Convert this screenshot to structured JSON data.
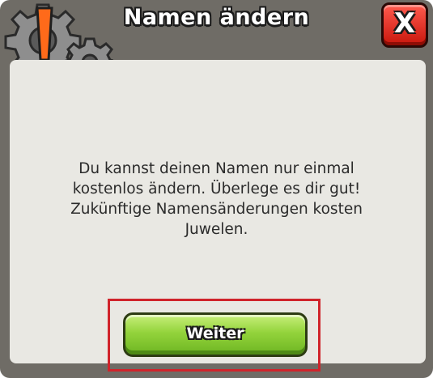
{
  "dialog": {
    "title": "Namen ändern",
    "close_label": "X",
    "message": "Du kannst deinen Namen nur einmal\nkostenlos ändern. Überlege es dir gut!\nZukünftige Namensänderungen kosten\nJuwelen.",
    "continue_label": "Weiter"
  },
  "icons": {
    "settings_warning": "gear-warning-icon",
    "close": "close-icon"
  },
  "colors": {
    "frame": "#6f6c66",
    "panel": "#e9e8e3",
    "close_button": "#e0281d",
    "continue_button": "#8fd13a",
    "highlight": "#d0242b"
  }
}
